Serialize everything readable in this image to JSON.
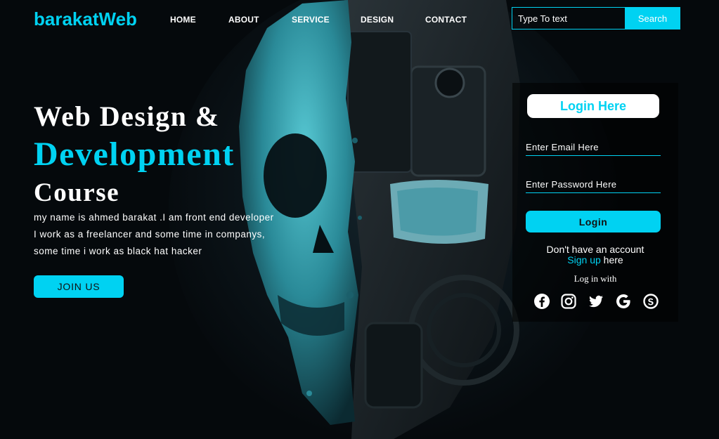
{
  "header": {
    "logo": "barakatWeb",
    "nav": [
      "HOME",
      "ABOUT",
      "SERVICE",
      "DESIGN",
      "CONTACT"
    ],
    "search": {
      "placeholder": "Type To text",
      "button": "Search"
    }
  },
  "hero": {
    "title_line1": "Web Design &",
    "title_line2": "Development",
    "title_line3": "Course",
    "paragraph": [
      "my name is ahmed barakat .I am front end developer",
      "I work as a freelancer and some time in companys,",
      "some time i work as black hat hacker"
    ],
    "button": "JOIN US"
  },
  "login": {
    "title": "Login Here",
    "email_placeholder": "Enter Email Here",
    "password_placeholder": "Enter Password Here",
    "button": "Login",
    "account_text": "Don't have an account",
    "signup_link": "Sign up",
    "signup_suffix": "here",
    "login_with": "Log in with",
    "social_icons": [
      "facebook-icon",
      "instagram-icon",
      "twitter-icon",
      "google-icon",
      "skype-icon"
    ]
  },
  "colors": {
    "accent": "#00d2f2",
    "background": "#05090c",
    "text": "#ffffff"
  }
}
